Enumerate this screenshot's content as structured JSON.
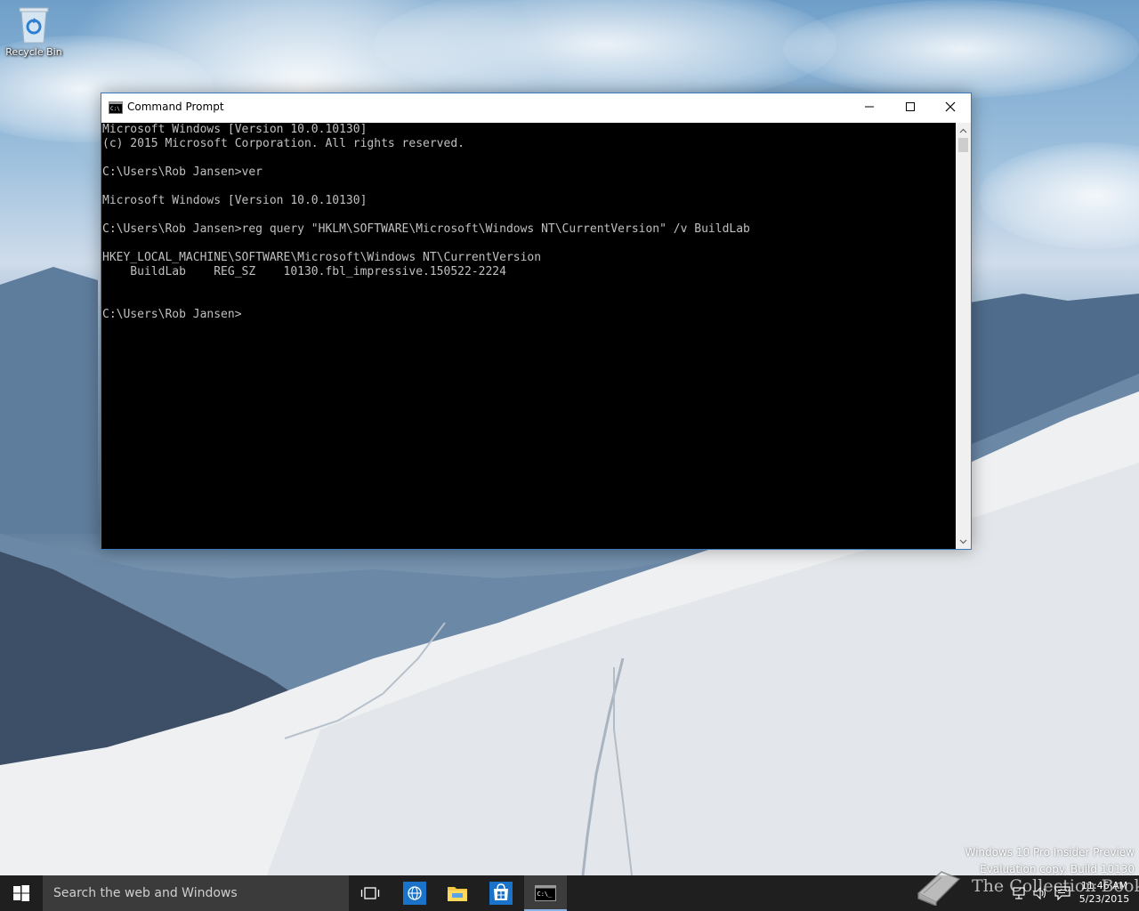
{
  "desktop": {
    "icons": [
      {
        "label": "Recycle Bin"
      }
    ],
    "watermark": {
      "line1": "Windows 10 Pro Insider Preview",
      "line2": "Evaluation copy. Build 10130"
    },
    "brand_text": "The Collection Book"
  },
  "window": {
    "title": "Command Prompt",
    "console_lines": [
      "Microsoft Windows [Version 10.0.10130]",
      "(c) 2015 Microsoft Corporation. All rights reserved.",
      "",
      "C:\\Users\\Rob Jansen>ver",
      "",
      "Microsoft Windows [Version 10.0.10130]",
      "",
      "C:\\Users\\Rob Jansen>reg query \"HKLM\\SOFTWARE\\Microsoft\\Windows NT\\CurrentVersion\" /v BuildLab",
      "",
      "HKEY_LOCAL_MACHINE\\SOFTWARE\\Microsoft\\Windows NT\\CurrentVersion",
      "    BuildLab    REG_SZ    10130.fbl_impressive.150522-2224",
      "",
      "",
      "C:\\Users\\Rob Jansen>"
    ]
  },
  "taskbar": {
    "search_placeholder": "Search the web and Windows",
    "clock": {
      "time": "11:46 AM",
      "date": "5/23/2015"
    }
  },
  "colors": {
    "taskbar_bg": "#1f1f1f",
    "console_bg": "#000000",
    "console_text": "#c0c0c0",
    "window_border": "#3b77bd",
    "active_indicator": "#8ab4e8"
  }
}
